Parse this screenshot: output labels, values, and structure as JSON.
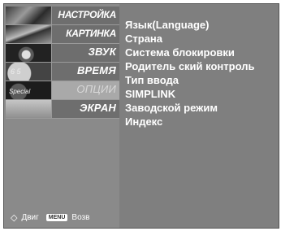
{
  "menu": {
    "tabs": [
      {
        "label": "НАСТРОЙКА",
        "thumb": "setup-thumbnail"
      },
      {
        "label": "КАРТИНКА",
        "thumb": "picture-thumbnail"
      },
      {
        "label": "ЗВУК",
        "thumb": "audio-thumbnail"
      },
      {
        "label": "ВРЕМЯ",
        "thumb": "clock-thumbnail"
      },
      {
        "label": "ОПЦИИ",
        "thumb": "options-thumbnail",
        "selected": true
      },
      {
        "label": "ЭКРАН",
        "thumb": "screen-thumbnail"
      }
    ],
    "items": [
      "Язык(Language)",
      "Страна",
      "Система блокировки",
      "Родитель ский контроль",
      "Тип ввода",
      "SIMPLINK",
      "Заводской режим",
      "Индекс"
    ],
    "clock_digits": "6 5",
    "special_text": "Special"
  },
  "footer": {
    "move_label": "Двиг",
    "menu_key": "MENU",
    "back_label": "Возв"
  },
  "colors": {
    "panel": "#8a8a8a",
    "tab": "#6e6e6e",
    "selected_tab": "#a9a9a9",
    "text": "#ffffff"
  }
}
